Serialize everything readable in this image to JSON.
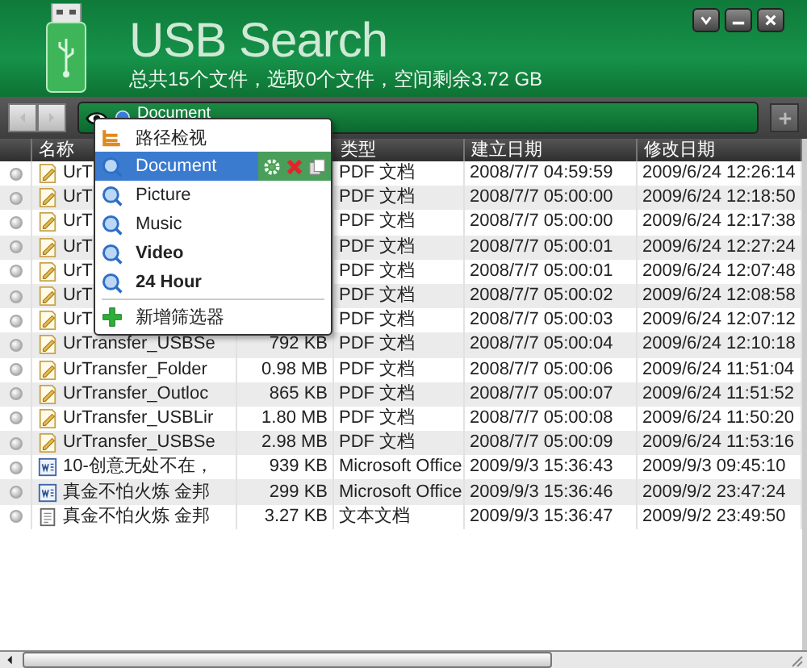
{
  "window": {
    "title": "USB Search",
    "summary": "总共15个文件，选取0个文件，空间剩余3.72 GB"
  },
  "filter": {
    "value": "Document"
  },
  "menu": {
    "items": [
      {
        "kind": "view",
        "label": "路径检视",
        "selected": false,
        "emphasized": false
      },
      {
        "kind": "filter",
        "label": "Document",
        "selected": true,
        "emphasized": false
      },
      {
        "kind": "filter",
        "label": "Picture",
        "selected": false,
        "emphasized": false
      },
      {
        "kind": "filter",
        "label": "Music",
        "selected": false,
        "emphasized": false
      },
      {
        "kind": "filter",
        "label": "Video",
        "selected": false,
        "emphasized": true
      },
      {
        "kind": "filter",
        "label": "24 Hour",
        "selected": false,
        "emphasized": true
      },
      {
        "kind": "add",
        "label": "新增筛选器",
        "selected": false,
        "emphasized": false
      }
    ]
  },
  "table": {
    "columns": [
      "名称",
      "类型",
      "建立日期",
      "修改日期"
    ],
    "rows": [
      {
        "kind": "pdf",
        "name": "UrT",
        "type": "PDF 文档",
        "created": "2008/7/7 04:59:59",
        "modified": "2009/6/24 12:26:14"
      },
      {
        "kind": "pdf",
        "name": "UrT",
        "type": "PDF 文档",
        "created": "2008/7/7 05:00:00",
        "modified": "2009/6/24 12:18:50"
      },
      {
        "kind": "pdf",
        "name": "UrT",
        "type": "PDF 文档",
        "created": "2008/7/7 05:00:00",
        "modified": "2009/6/24 12:17:38"
      },
      {
        "kind": "pdf",
        "name": "UrT",
        "type": "PDF 文档",
        "created": "2008/7/7 05:00:01",
        "modified": "2009/6/24 12:27:24"
      },
      {
        "kind": "pdf",
        "name": "UrT",
        "type": "PDF 文档",
        "created": "2008/7/7 05:00:01",
        "modified": "2009/6/24 12:07:48"
      },
      {
        "kind": "pdf",
        "name": "UrT",
        "type": "PDF 文档",
        "created": "2008/7/7 05:00:02",
        "modified": "2009/6/24 12:08:58"
      },
      {
        "kind": "pdf",
        "name": "UrT",
        "type": "PDF 文档",
        "created": "2008/7/7 05:00:03",
        "modified": "2009/6/24 12:07:12"
      },
      {
        "kind": "pdf",
        "name": "UrTransfer_USBSe",
        "size": "792 KB",
        "type": "PDF 文档",
        "created": "2008/7/7 05:00:04",
        "modified": "2009/6/24 12:10:18"
      },
      {
        "kind": "pdf",
        "name": "UrTransfer_Folder",
        "size": "0.98 MB",
        "type": "PDF 文档",
        "created": "2008/7/7 05:00:06",
        "modified": "2009/6/24 11:51:04"
      },
      {
        "kind": "pdf",
        "name": "UrTransfer_Outloc",
        "size": "865 KB",
        "type": "PDF 文档",
        "created": "2008/7/7 05:00:07",
        "modified": "2009/6/24 11:51:52"
      },
      {
        "kind": "pdf",
        "name": "UrTransfer_USBLir",
        "size": "1.80 MB",
        "type": "PDF 文档",
        "created": "2008/7/7 05:00:08",
        "modified": "2009/6/24 11:50:20"
      },
      {
        "kind": "pdf",
        "name": "UrTransfer_USBSe",
        "size": "2.98 MB",
        "type": "PDF 文档",
        "created": "2008/7/7 05:00:09",
        "modified": "2009/6/24 11:53:16"
      },
      {
        "kind": "word",
        "name": "10-创意无处不在，",
        "size": "939 KB",
        "type": "Microsoft Office",
        "created": "2009/9/3 15:36:43",
        "modified": "2009/9/3 09:45:10"
      },
      {
        "kind": "word",
        "name": "真金不怕火炼 金邦",
        "size": "299 KB",
        "type": "Microsoft Office",
        "created": "2009/9/3 15:36:46",
        "modified": "2009/9/2 23:47:24"
      },
      {
        "kind": "text",
        "name": "真金不怕火炼 金邦",
        "size": "3.27 KB",
        "type": "文本文档",
        "created": "2009/9/3 15:36:47",
        "modified": "2009/9/2 23:49:50"
      }
    ]
  }
}
